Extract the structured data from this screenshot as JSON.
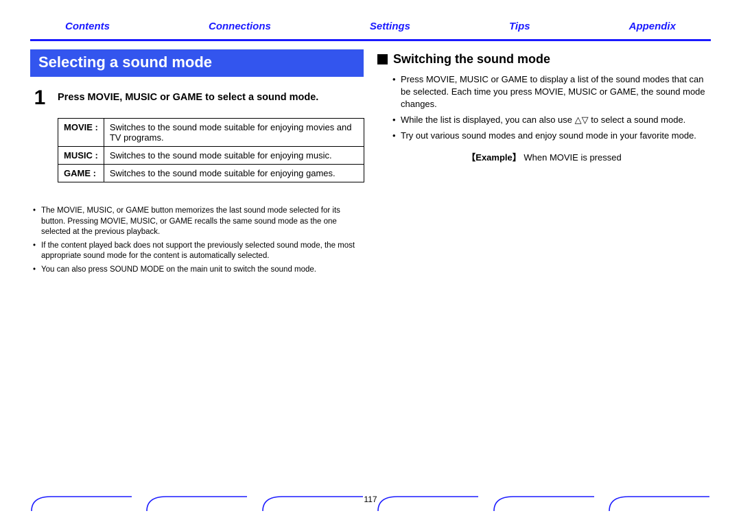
{
  "nav": {
    "contents": "Contents",
    "connections": "Connections",
    "settings": "Settings",
    "tips": "Tips",
    "appendix": "Appendix"
  },
  "left": {
    "title": "Selecting a sound mode",
    "step_num": "1",
    "step_text": "Press MOVIE, MUSIC or GAME to select a sound mode.",
    "table": {
      "movie_label": "MOVIE :",
      "movie_desc": "Switches to the sound mode suitable for enjoying movies and TV programs.",
      "music_label": "MUSIC :",
      "music_desc": "Switches to the sound mode suitable for enjoying music.",
      "game_label": "GAME :",
      "game_desc": "Switches to the sound mode suitable for enjoying games."
    },
    "notes": {
      "n1": "The MOVIE, MUSIC, or GAME button memorizes the last sound mode selected for its button. Pressing MOVIE, MUSIC, or GAME recalls the same sound mode as the one selected at the previous playback.",
      "n2": "If the content played back does not support the previously selected sound mode, the most appropriate sound mode for the content is automatically selected.",
      "n3": "You can also press SOUND MODE on the main unit to switch the sound mode."
    }
  },
  "right": {
    "heading": "Switching the sound mode",
    "b1_a": "Press MOVIE, MUSIC or GAME to display a list of the sound modes that can be selected. Each time you press MOVIE, MUSIC or GAME, the sound mode changes.",
    "b2_a": "While the list is displayed, you can also use ",
    "b2_b": " to select a sound mode.",
    "b3": "Try out various sound modes and enjoy sound mode in your favorite mode.",
    "example_label": "【Example】",
    "example_text": " When MOVIE is pressed"
  },
  "page": "117"
}
